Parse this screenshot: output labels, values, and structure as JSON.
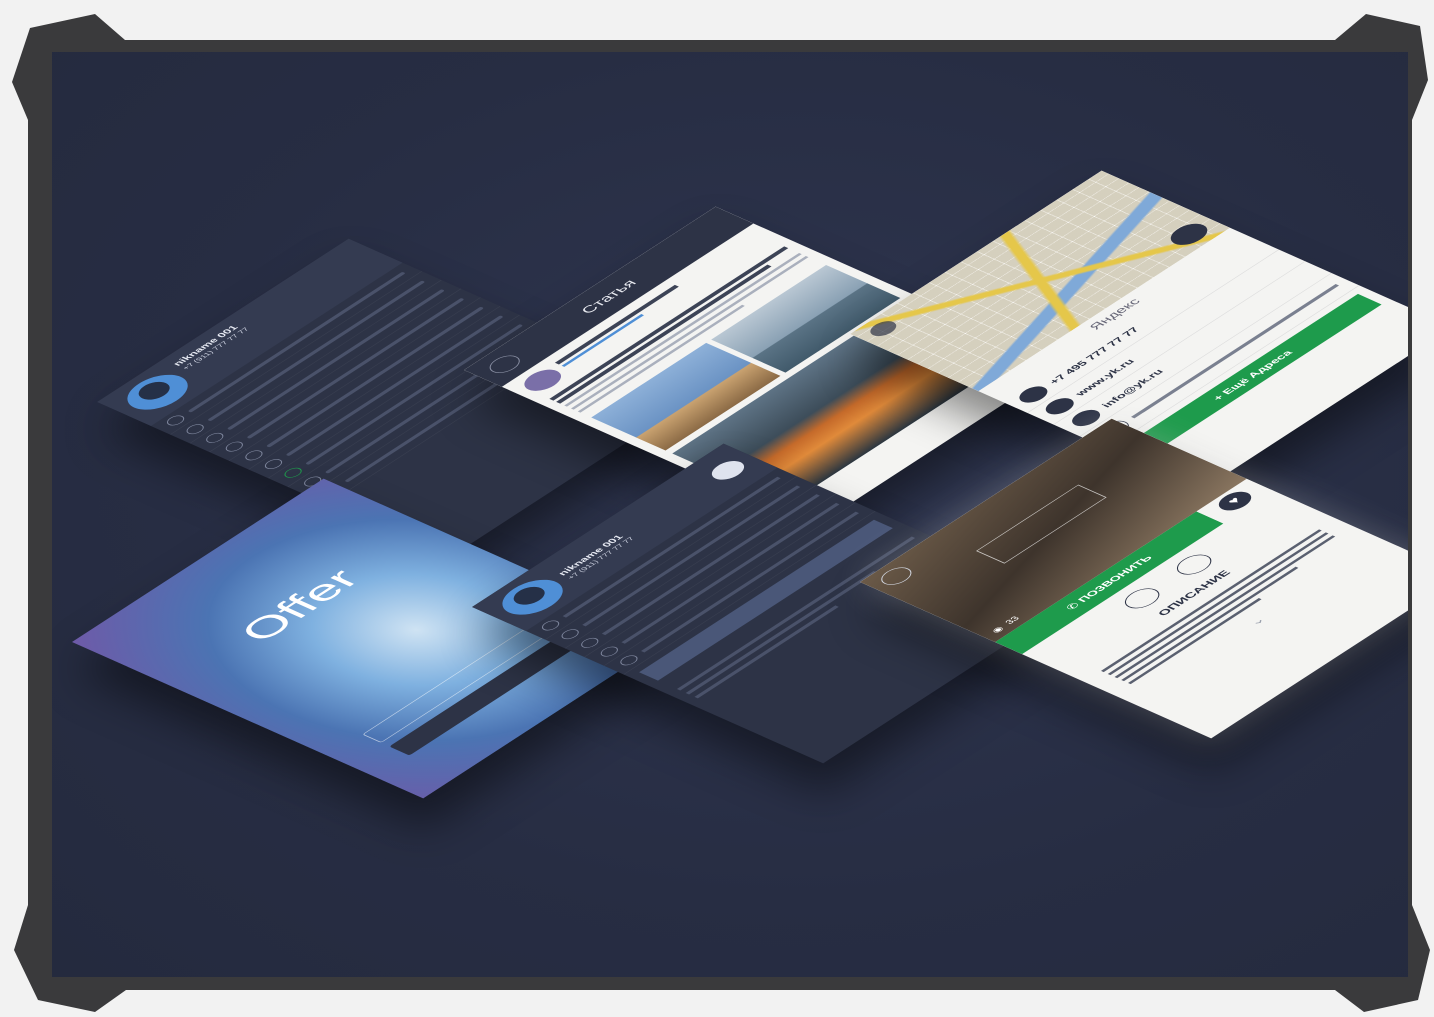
{
  "colors": {
    "background": "#272d43",
    "frame": "#3a3a3c",
    "accent_green": "#1e9b4c",
    "accent_blue": "#4f8fd6"
  },
  "profile_screen": {
    "username": "nikname 001",
    "phone": "+7 (911) 777 77 77",
    "menu_items": [
      "",
      "",
      "",
      "",
      "",
      "",
      "",
      "",
      ""
    ]
  },
  "offer_screen": {
    "logo": "Offer"
  },
  "article_screen": {
    "title": "Статья"
  },
  "map_screen": {
    "brand": "Яндекс",
    "phone": "+7 495 777 77 77",
    "website": "www.yk.ru",
    "email": "info@yk.ru",
    "button": "+ Ещё Адреса"
  },
  "profile_screen_2": {
    "username": "nikname 001",
    "phone": "+7 (911) 777 77 77"
  },
  "restaurant_screen": {
    "badge": "33",
    "call_button": "ПОЗВОНИТЬ",
    "description_title": "ОПИСАНИЕ"
  }
}
